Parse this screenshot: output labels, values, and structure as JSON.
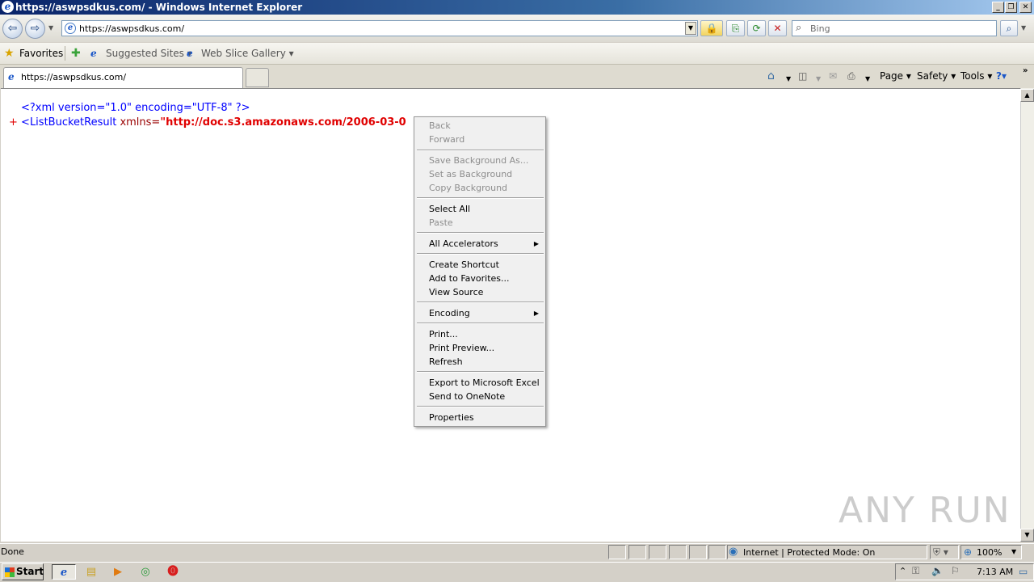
{
  "window": {
    "title": "https://aswpsdkus.com/ - Windows Internet Explorer",
    "min_label": "_",
    "max_label": "❐",
    "close_label": "✕"
  },
  "nav": {
    "url": "https://aswpsdkus.com/",
    "search_placeholder": "Bing",
    "back_glyph": "⇦",
    "forward_glyph": "⇨"
  },
  "favorites_bar": {
    "favorites_label": "Favorites",
    "items": [
      "Suggested Sites ▾",
      "Web Slice Gallery ▾"
    ]
  },
  "tab": {
    "label": "https://aswpsdkus.com/"
  },
  "command_bar": {
    "page": "Page ▾",
    "safety": "Safety ▾",
    "tools": "Tools ▾",
    "help": "?▾"
  },
  "content": {
    "line1": "<?xml version=\"1.0\" encoding=\"UTF-8\" ?>",
    "line2_plus": "+",
    "line2_tag": "<ListBucketResult",
    "line2_attr": " xmlns=",
    "line2_value": "\"http://doc.s3.amazonaws.com/2006-03-0"
  },
  "context_menu": {
    "items": [
      {
        "label": "Back",
        "disabled": true
      },
      {
        "label": "Forward",
        "disabled": true
      },
      {
        "label": "Save Background As...",
        "disabled": true
      },
      {
        "label": "Set as Background",
        "disabled": true
      },
      {
        "label": "Copy Background",
        "disabled": true
      },
      {
        "label": "Select All",
        "disabled": false
      },
      {
        "label": "Paste",
        "disabled": true
      },
      {
        "label": "All Accelerators",
        "disabled": false,
        "submenu": true
      },
      {
        "label": "Create Shortcut",
        "disabled": false
      },
      {
        "label": "Add to Favorites...",
        "disabled": false
      },
      {
        "label": "View Source",
        "disabled": false
      },
      {
        "label": "Encoding",
        "disabled": false,
        "submenu": true
      },
      {
        "label": "Print...",
        "disabled": false
      },
      {
        "label": "Print Preview...",
        "disabled": false
      },
      {
        "label": "Refresh",
        "disabled": false
      },
      {
        "label": "Export to Microsoft Excel",
        "disabled": false
      },
      {
        "label": "Send to OneNote",
        "disabled": false
      },
      {
        "label": "Properties",
        "disabled": false
      }
    ]
  },
  "status": {
    "left": "Done",
    "zone": "Internet | Protected Mode: On",
    "zoom": "100%"
  },
  "taskbar": {
    "start_label": "Start",
    "clock": "7:13 AM"
  },
  "watermark": "ANY RUN",
  "colors": {
    "xml_blue": "#0000ff",
    "xml_red": "#e00000",
    "titlebar": "#0a246a"
  }
}
